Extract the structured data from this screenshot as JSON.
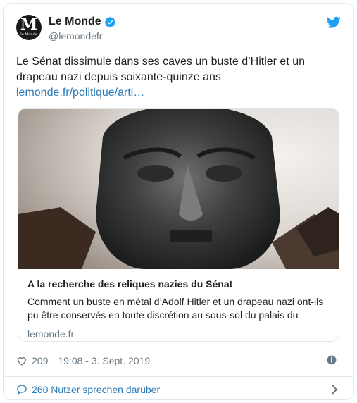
{
  "author": {
    "display_name": "Le Monde",
    "handle": "@lemondefr",
    "avatar_big": "M",
    "avatar_small": "le Monde",
    "verified": true
  },
  "tweet": {
    "text": "Le Sénat dissimule dans ses caves un buste d’Hitler et un drapeau nazi depuis soixante-quinze ans",
    "link": "lemonde.fr/politique/arti…"
  },
  "card": {
    "title": "A la recherche des reliques nazies du Sénat",
    "description": "Comment un buste en métal d’Adolf Hitler et un drapeau nazi ont-ils pu être conservés en toute discrétion au sous-sol du palais du",
    "domain": "lemonde.fr"
  },
  "meta": {
    "likes": "209",
    "timestamp": "19:08 - 3. Sept. 2019"
  },
  "footer": {
    "conversation": "260 Nutzer sprechen darüber"
  },
  "colors": {
    "link": "#2b7bb9",
    "secondary": "#697882",
    "border": "#e1e8ed",
    "verified": "#1da1f2"
  }
}
